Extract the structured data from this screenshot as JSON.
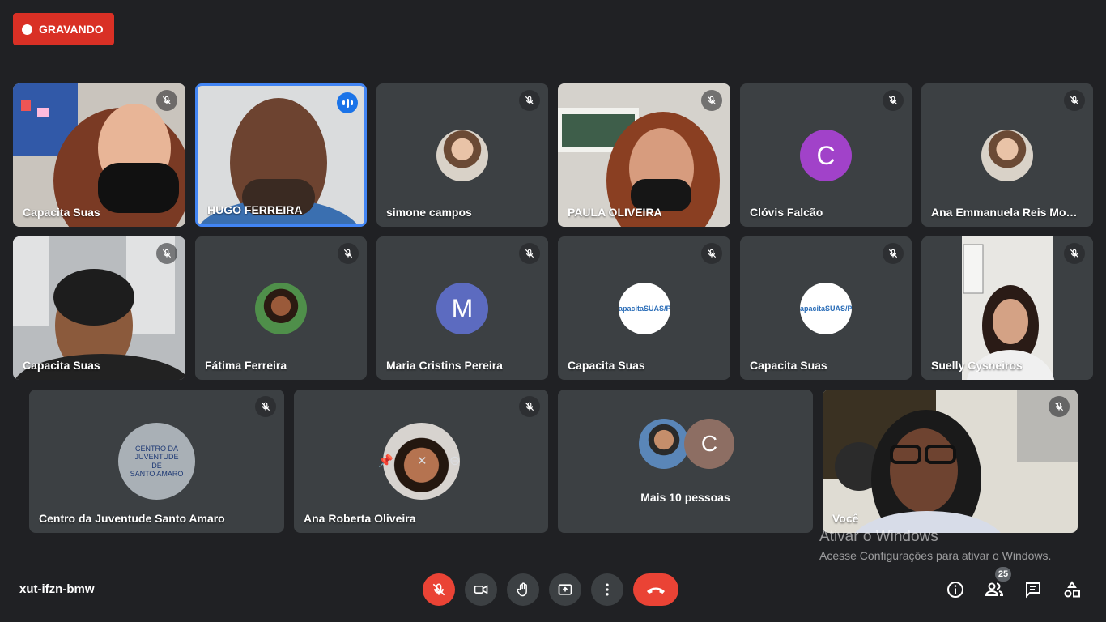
{
  "recording": {
    "label": "GRAVANDO"
  },
  "participants": [
    {
      "name": "Capacita Suas",
      "type": "video",
      "muted": true
    },
    {
      "name": "HUGO FERREIRA",
      "type": "video",
      "speaking": true
    },
    {
      "name": "simone campos",
      "type": "photo-avatar",
      "muted": true
    },
    {
      "name": "PAULA OLIVEIRA",
      "type": "video",
      "muted": true
    },
    {
      "name": "Clóvis Falcão",
      "type": "letter-avatar",
      "letter": "C",
      "avatar_color": "#a142c9",
      "muted": true
    },
    {
      "name": "Ana Emmanuela Reis Mont...",
      "type": "photo-avatar",
      "muted": true
    },
    {
      "name": "Capacita Suas",
      "type": "video",
      "muted": true
    },
    {
      "name": "Fátima Ferreira",
      "type": "photo-avatar",
      "muted": true
    },
    {
      "name": "Maria Cristins Pereira",
      "type": "letter-avatar",
      "letter": "M",
      "avatar_color": "#5c6bc0",
      "muted": true
    },
    {
      "name": "Capacita Suas",
      "type": "logo-avatar",
      "logo_text": "CapacitaSUAS/PE",
      "muted": true
    },
    {
      "name": "Capacita Suas",
      "type": "logo-avatar",
      "logo_text": "CapacitaSUAS/PE",
      "muted": true
    },
    {
      "name": "Suelly Cysneiros",
      "type": "video",
      "muted": true
    },
    {
      "name": "Centro da Juventude Santo Amaro",
      "type": "logo-avatar",
      "logo_lines": [
        "CENTRO DA JUVENTUDE",
        "DE",
        "SANTO AMARO"
      ],
      "muted": true
    },
    {
      "name": "Ana Roberta Oliveira",
      "type": "photo-avatar",
      "muted": true
    },
    {
      "more_label": "Mais 10 pessoas",
      "type": "more",
      "letter": "C",
      "avatar_color": "#8d6e63"
    },
    {
      "name": "Você",
      "type": "video",
      "muted": true
    }
  ],
  "watermark": {
    "title": "Ativar o Windows",
    "subtitle": "Acesse Configurações para ativar o Windows."
  },
  "bottom_bar": {
    "meeting_code": "xut-ifzn-bmw",
    "participant_count": "25",
    "controls": [
      "mic-off",
      "camera",
      "raise-hand",
      "present",
      "more-options",
      "end-call"
    ],
    "right_icons": [
      "info",
      "people",
      "chat",
      "activities"
    ]
  },
  "colors": {
    "background": "#202124",
    "tile": "#3c4043",
    "red": "#ea4335",
    "speaking_border": "#4285f4"
  }
}
